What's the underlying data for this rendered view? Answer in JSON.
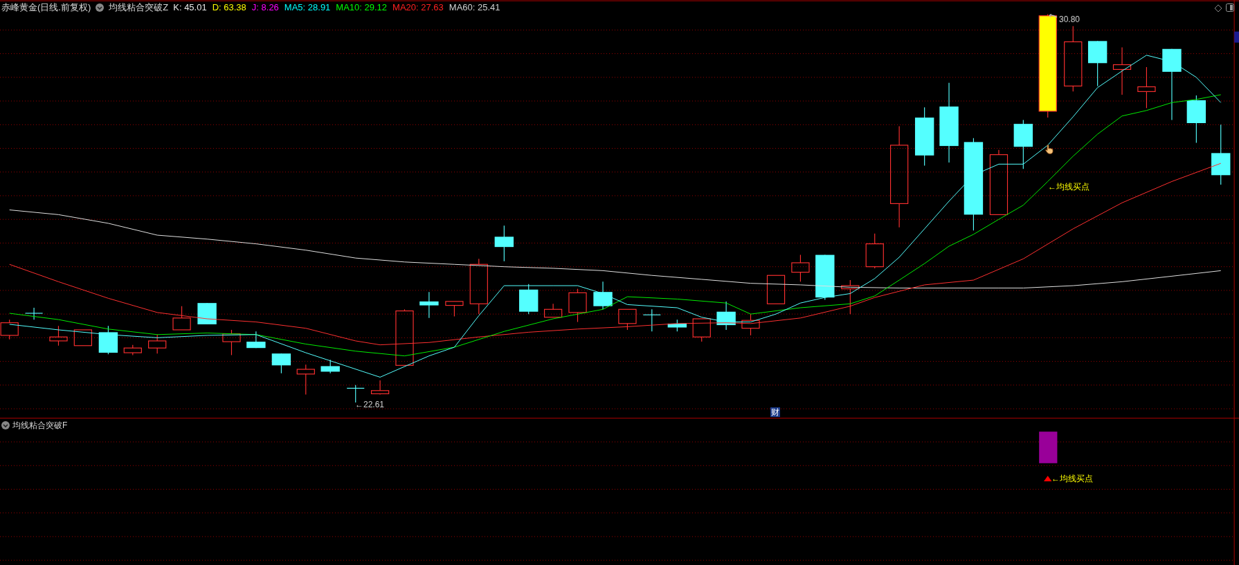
{
  "header": {
    "title": "赤峰黄金(日线.前复权)",
    "indicator": "均线粘合突破Z",
    "values": [
      {
        "label": "K: 45.01",
        "color": "#e8e8e8"
      },
      {
        "label": "D: 63.38",
        "color": "#ffff00"
      },
      {
        "label": "J: 8.26",
        "color": "#ff00ff"
      },
      {
        "label": "MA5: 28.91",
        "color": "#00ffff"
      },
      {
        "label": "MA10: 29.12",
        "color": "#00ff00"
      },
      {
        "label": "MA20: 27.63",
        "color": "#ff2020"
      },
      {
        "label": "MA60: 25.41",
        "color": "#d0d0d0"
      }
    ]
  },
  "main_chart": {
    "high_label": "30.80",
    "low_label": "←22.61",
    "signal_label": "←均线买点",
    "finance_badge": "财"
  },
  "sub_panel": {
    "title": "均线粘合突破F",
    "signal_label": "←均线买点"
  }
}
